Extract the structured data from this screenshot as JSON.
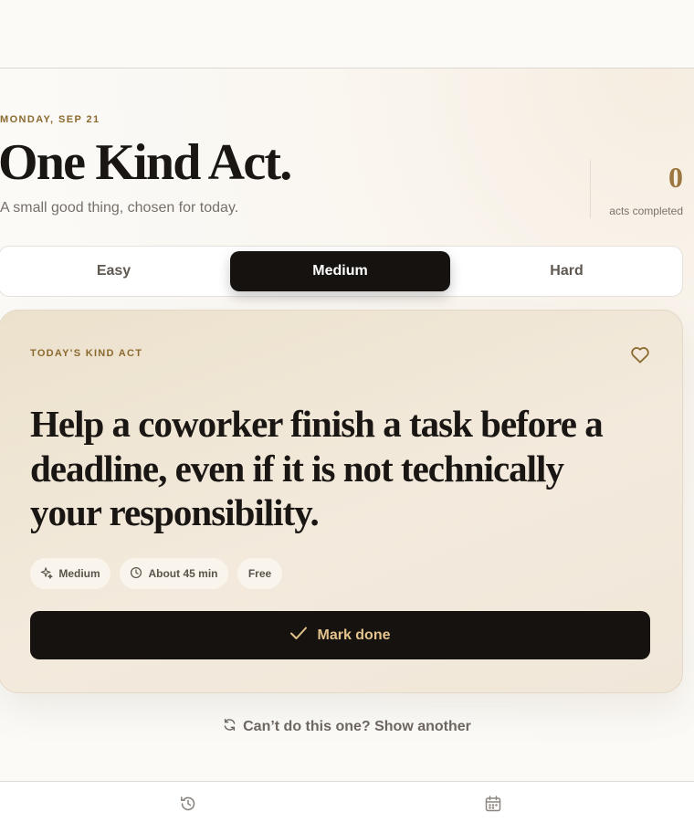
{
  "header": {
    "date": "MONDAY, SEP 21",
    "title": "One Kind Act.",
    "subtitle": "A small good thing, chosen for today."
  },
  "stats": {
    "count": "0",
    "count_label": "acts completed"
  },
  "difficulty_tabs": [
    {
      "label": "Easy",
      "selected": false
    },
    {
      "label": "Medium",
      "selected": true
    },
    {
      "label": "Hard",
      "selected": false
    }
  ],
  "card": {
    "label": "TODAY'S KIND ACT",
    "favorite_icon": "heart-outline-icon",
    "act_text": "Help a coworker finish a task before a deadline, even if it is not technically your responsibility.",
    "chips": [
      {
        "icon": "sparkle-icon",
        "label": "Medium"
      },
      {
        "icon": "clock-icon",
        "label": "About 45 min"
      },
      {
        "icon": "",
        "label": "Free"
      }
    ],
    "mark_done_label": "Mark done"
  },
  "show_another_label": "Can’t do this one? Show another",
  "bottom_nav": [
    {
      "icon": "history-icon"
    },
    {
      "icon": "calendar-icon"
    }
  ],
  "colors": {
    "accent_gold": "#8a6a2f",
    "dark": "#161210",
    "button_text": "#e2c48c",
    "card_bg": "#ece1cc"
  }
}
